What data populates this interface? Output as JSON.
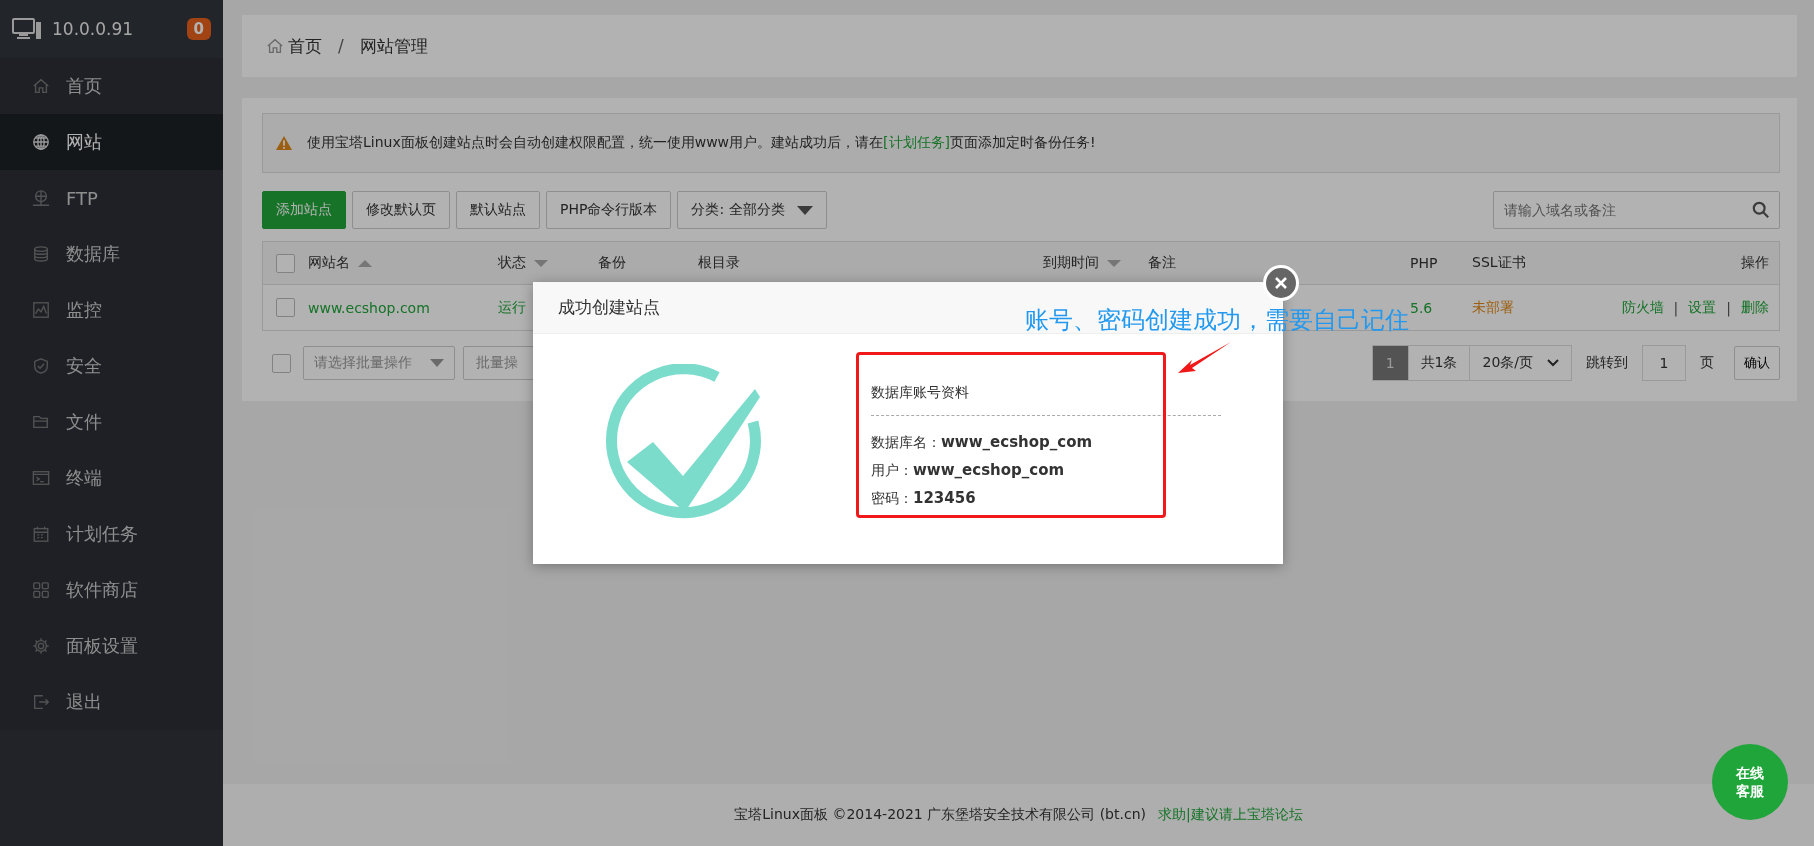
{
  "sidebar": {
    "host": "10.0.0.91",
    "badge": "0",
    "items": [
      {
        "label": "首页",
        "selected": false
      },
      {
        "label": "网站",
        "selected": true
      },
      {
        "label": "FTP",
        "selected": false
      },
      {
        "label": "数据库",
        "selected": false
      },
      {
        "label": "监控",
        "selected": false
      },
      {
        "label": "安全",
        "selected": false
      },
      {
        "label": "文件",
        "selected": false
      },
      {
        "label": "终端",
        "selected": false
      },
      {
        "label": "计划任务",
        "selected": false
      },
      {
        "label": "软件商店",
        "selected": false
      },
      {
        "label": "面板设置",
        "selected": false
      },
      {
        "label": "退出",
        "selected": false
      }
    ]
  },
  "breadcrumb": [
    {
      "label": "首页",
      "kind": "link"
    },
    {
      "label": "/",
      "kind": "separator"
    },
    {
      "label": "网站管理",
      "kind": "link"
    }
  ],
  "notice": {
    "text": "使用宝塔Linux面板创建站点时会自动创建权限配置，统一使用www用户。建站成功后，请在",
    "link": "[计划任务]",
    "after": "页面添加定时备份任务!"
  },
  "toolbar": [
    {
      "label": "添加站点",
      "kind": "primary"
    },
    {
      "label": "修改默认页",
      "kind": "default"
    },
    {
      "label": "默认站点",
      "kind": "default"
    },
    {
      "label": "PHP命令行版本",
      "kind": "default"
    },
    {
      "label": "分类: 全部分类",
      "kind": "dropdown"
    }
  ],
  "search": {
    "placeholder": "请输入域名或备注"
  },
  "table": {
    "header_checked": false,
    "columns": [
      {
        "label": "网站名",
        "sortable": true,
        "ascending": true
      },
      {
        "label": "状态",
        "sortable": true,
        "ascending": false
      },
      {
        "label": "备份",
        "sortable": false
      },
      {
        "label": "根目录",
        "sortable": false
      },
      {
        "label": "到期时间",
        "sortable": true,
        "ascending": false
      },
      {
        "label": "备注",
        "sortable": false
      },
      {
        "label": "PHP",
        "sortable": false
      },
      {
        "label": "SSL证书",
        "sortable": false
      },
      {
        "label": "操作",
        "sortable": false
      }
    ],
    "rows": [
      {
        "selected": false,
        "name": "www.ecshop.com",
        "status": "运行",
        "php": "5.6",
        "ssl": "未部署",
        "actions": [
          {
            "label": "防火墙",
            "kind": "link"
          },
          {
            "label": "|",
            "kind": "separator"
          },
          {
            "label": "设置",
            "kind": "link"
          },
          {
            "label": "|",
            "kind": "separator"
          },
          {
            "label": "删除",
            "kind": "link"
          }
        ]
      }
    ]
  },
  "batch": {
    "checked": false,
    "select_placeholder": "请选择批量操作",
    "button": "批量操"
  },
  "pagination": {
    "pages": [
      {
        "label": "1",
        "selected": true
      }
    ],
    "total": "共1条",
    "per_page": "20条/页",
    "jump_label": "跳转到",
    "jump_value": "1",
    "page_unit": "页",
    "confirm": "确认"
  },
  "dialog": {
    "title": "成功创建站点",
    "heading": "数据库账号资料",
    "fields": [
      {
        "label": "数据库名：",
        "value": "www_ecshop_com"
      },
      {
        "label": "用户：",
        "value": "www_ecshop_com"
      },
      {
        "label": "密码：",
        "value": "123456"
      }
    ],
    "annotation": "账号、密码创建成功，需要自己记住"
  },
  "footer": {
    "text": "宝塔Linux面板 ©2014-2021 广东堡塔安全技术有限公司 (bt.cn)",
    "link": "求助|建议请上宝塔论坛"
  },
  "chat": [
    "在线",
    "客服"
  ]
}
